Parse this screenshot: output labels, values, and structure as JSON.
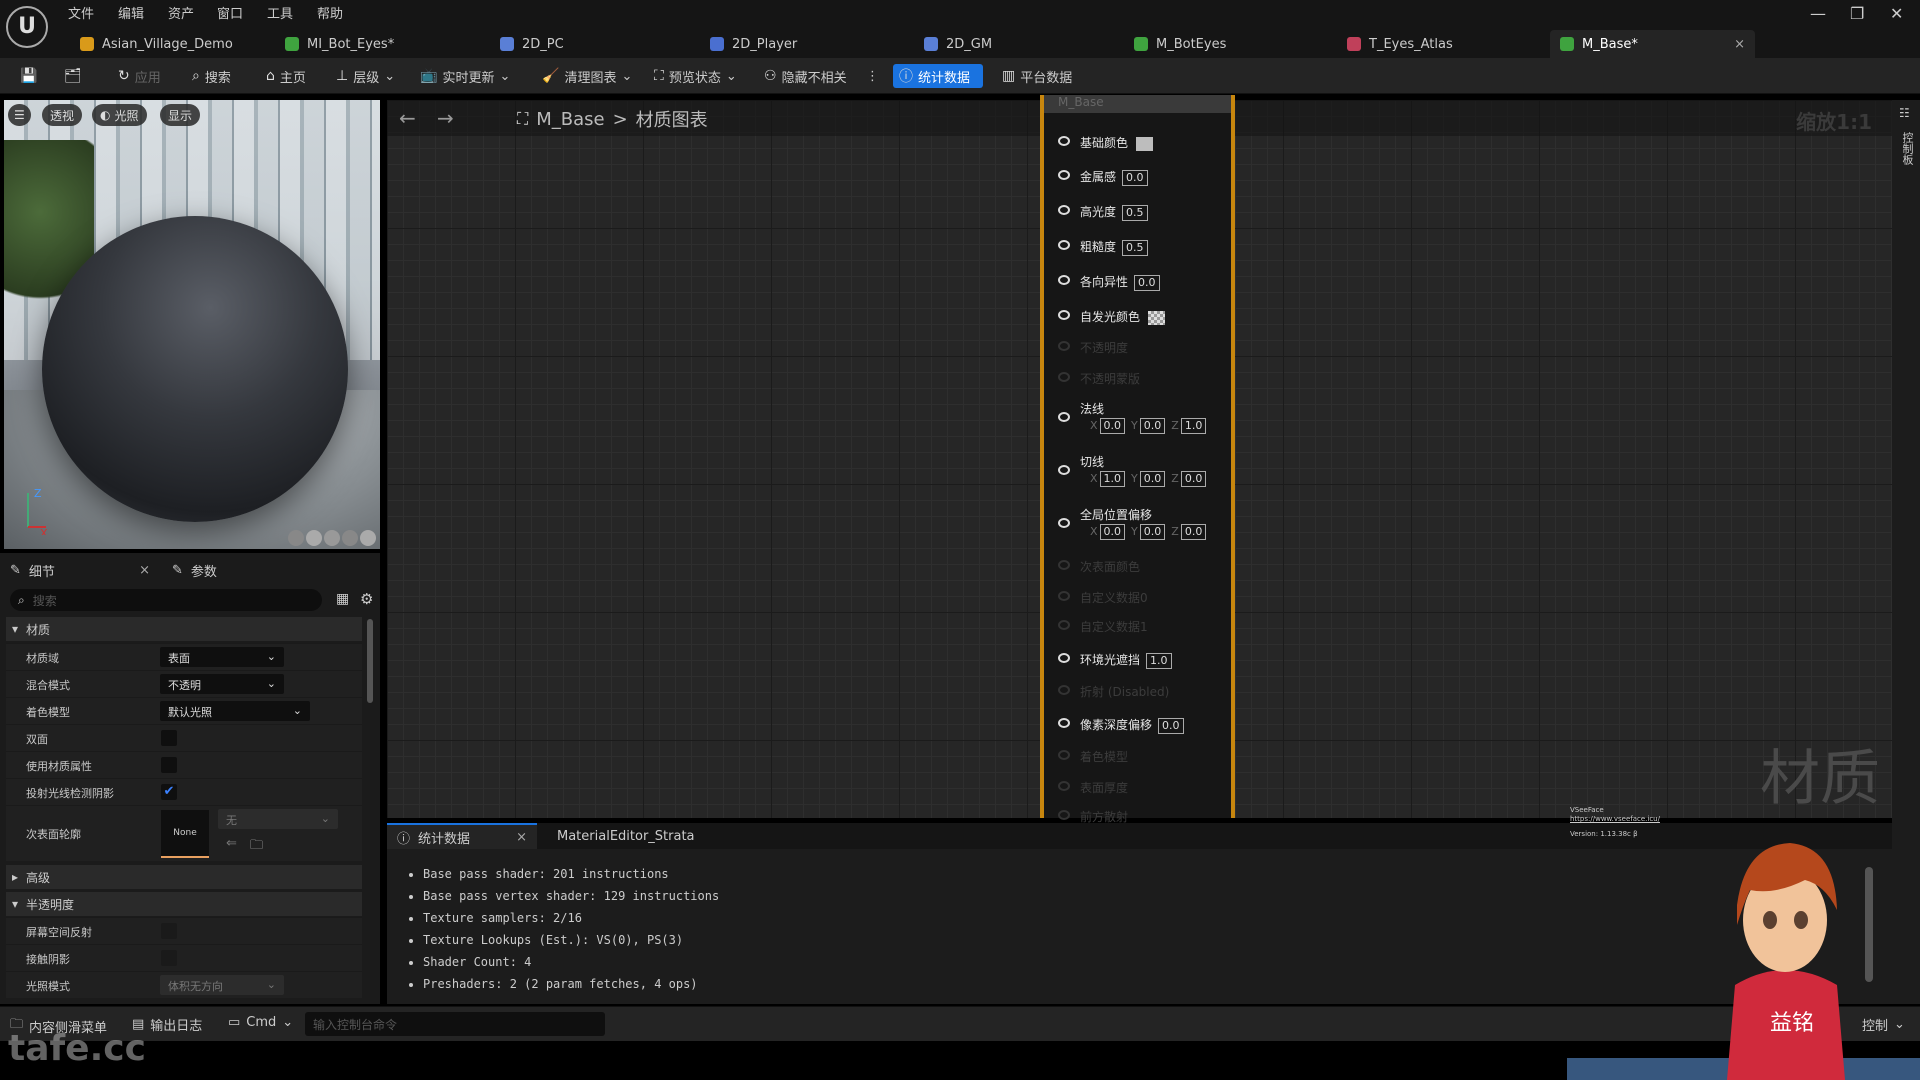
{
  "menu": [
    "文件",
    "编辑",
    "资产",
    "窗口",
    "工具",
    "帮助"
  ],
  "tabs": [
    {
      "label": "Asian_Village_Demo",
      "color": "#d99a1a"
    },
    {
      "label": "MI_Bot_Eyes*",
      "color": "#3fa33f"
    },
    {
      "label": "2D_PC",
      "color": "#5a7fd6"
    },
    {
      "label": "2D_Player",
      "color": "#4a6fd0"
    },
    {
      "label": "2D_GM",
      "color": "#5a7fd6"
    },
    {
      "label": "M_BotEyes",
      "color": "#3fa33f"
    },
    {
      "label": "T_Eyes_Atlas",
      "color": "#c0405a"
    },
    {
      "label": "M_Base*",
      "color": "#3fa33f",
      "active": true
    }
  ],
  "toolbar": {
    "apply": "应用",
    "search": "搜索",
    "home": "主页",
    "hierarchy": "层级",
    "live_update": "实时更新",
    "clean_graph": "清理图表",
    "preview_state": "预览状态",
    "hide_unrelated": "隐藏不相关",
    "stats": "统计数据",
    "platform_stats": "平台数据"
  },
  "viewport": {
    "perspective": "透视",
    "lit": "光照",
    "show": "显示",
    "axis_z": "Z",
    "axis_x": "X"
  },
  "details": {
    "tab_details": "细节",
    "tab_params": "参数",
    "search_placeholder": "搜索",
    "sections": {
      "material": "材质",
      "advanced": "高级",
      "translucency": "半透明度"
    },
    "rows": {
      "domain": {
        "label": "材质域",
        "value": "表面"
      },
      "blend": {
        "label": "混合模式",
        "value": "不透明"
      },
      "shading": {
        "label": "着色模型",
        "value": "默认光照"
      },
      "two_sided": {
        "label": "双面",
        "checked": false
      },
      "use_attrs": {
        "label": "使用材质属性",
        "checked": false
      },
      "raytrace_shadow": {
        "label": "投射光线检测阴影",
        "checked": true
      },
      "subsurface": {
        "label": "次表面轮廓",
        "thumb": "None",
        "value": "无"
      },
      "ssr": {
        "label": "屏幕空间反射",
        "checked": false
      },
      "contact_shadow": {
        "label": "接触阴影",
        "checked": false
      },
      "lighting_mode": {
        "label": "光照模式",
        "value": "体积无方向"
      }
    }
  },
  "graph": {
    "asset": "M_Base",
    "separator": ">",
    "title": "材质图表",
    "zoom": "缩放1:1",
    "watermark": "材质",
    "panel_label": "控制板"
  },
  "node": {
    "title": "M_Base",
    "pins": [
      {
        "label": "基础颜色",
        "swatch": "#bdbdbd"
      },
      {
        "label": "金属感",
        "value": "0.0"
      },
      {
        "label": "高光度",
        "value": "0.5"
      },
      {
        "label": "粗糙度",
        "value": "0.5"
      },
      {
        "label": "各向异性",
        "value": "0.0"
      },
      {
        "label": "自发光颜色",
        "swatch": "checker"
      },
      {
        "label": "不透明度",
        "disabled": true
      },
      {
        "label": "不透明蒙版",
        "disabled": true
      },
      {
        "label": "法线",
        "vec": [
          "0.0",
          "0.0",
          "1.0"
        ]
      },
      {
        "label": "切线",
        "vec": [
          "1.0",
          "0.0",
          "0.0"
        ]
      },
      {
        "label": "全局位置偏移",
        "vec": [
          "0.0",
          "0.0",
          "0.0"
        ]
      },
      {
        "label": "次表面颜色",
        "disabled": true
      },
      {
        "label": "自定义数据0",
        "disabled": true
      },
      {
        "label": "自定义数据1",
        "disabled": true
      },
      {
        "label": "环境光遮挡",
        "value": "1.0"
      },
      {
        "label": "折射 (Disabled)",
        "disabled": true
      },
      {
        "label": "像素深度偏移",
        "value": "0.0"
      },
      {
        "label": "着色模型",
        "disabled": true
      },
      {
        "label": "表面厚度",
        "disabled": true
      },
      {
        "label": "前方散射",
        "disabled": true
      }
    ]
  },
  "stats": {
    "tab_stats": "统计数据",
    "tab_strata": "MaterialEditor_Strata",
    "lines": [
      "Base pass shader: 201 instructions",
      "Base pass vertex shader: 129 instructions",
      "Texture samplers: 2/16",
      "Texture Lookups (Est.): VS(0), PS(3)",
      "Shader Count: 4",
      "Preshaders: 2  (2 param fetches, 4 ops)"
    ]
  },
  "statusbar": {
    "content_drawer": "内容侧滑菜单",
    "output_log": "输出日志",
    "cmd": "Cmd",
    "cmd_placeholder": "输入控制台命令",
    "source_control": "控制"
  },
  "overlay": {
    "vseeface": "VSeeFace",
    "vseeface_url": "https://www.vseeface.icu/",
    "vseeface_version": "Version: 1.13.38c β",
    "watermark": "tafe.cc",
    "hoodie_text": "益铭"
  },
  "colors": {
    "accent": "#1a73e0",
    "node_border": "#c7860e"
  }
}
